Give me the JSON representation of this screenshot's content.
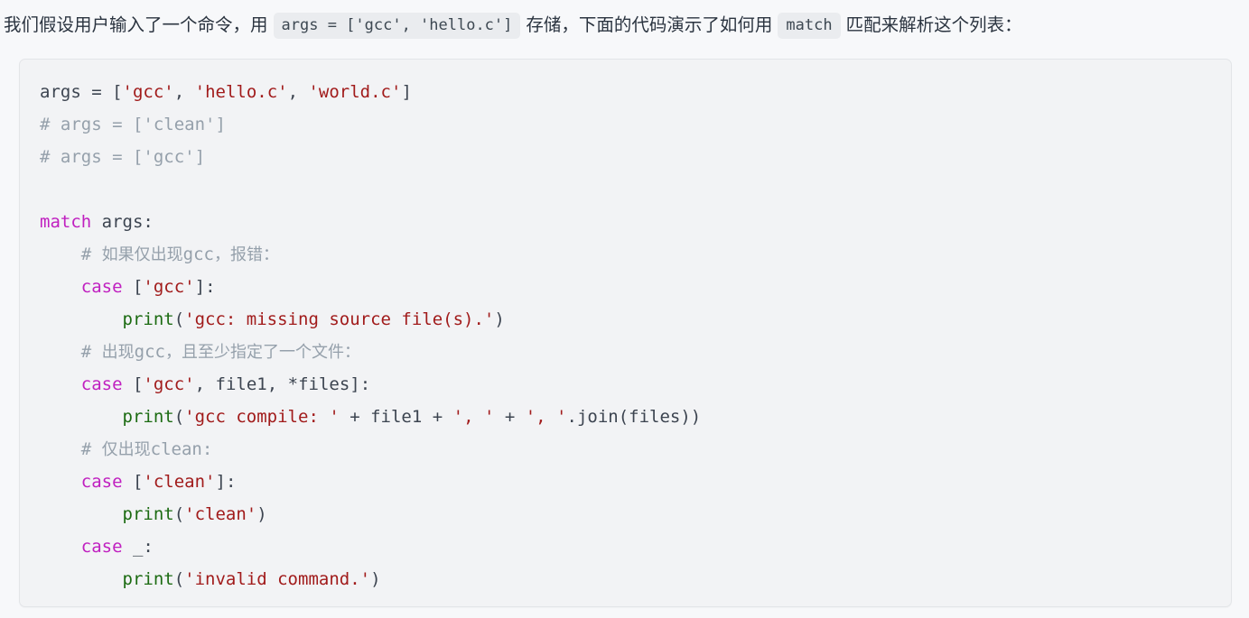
{
  "intro": {
    "segment_1": "我们假设用户输入了一个命令，用",
    "inline_code_1": "args = ['gcc', 'hello.c']",
    "segment_2": "存储，下面的代码演示了如何用",
    "inline_code_2": "match",
    "segment_3": "匹配来解析这个列表："
  },
  "code_block": {
    "language": "python",
    "background_color": "#f2f3f5",
    "border_color": "#e3e5e8",
    "colors": {
      "keyword": "#c020c0",
      "string": "#a11b1b",
      "comment": "#95a0ab",
      "function": "#1c6b12",
      "text": "#3c4450"
    },
    "lines": [
      {
        "indent": 0,
        "tokens": [
          {
            "t": "name",
            "v": "args"
          },
          {
            "t": "op",
            "v": " = "
          },
          {
            "t": "pun",
            "v": "["
          },
          {
            "t": "str",
            "v": "'gcc'"
          },
          {
            "t": "pun",
            "v": ", "
          },
          {
            "t": "str",
            "v": "'hello.c'"
          },
          {
            "t": "pun",
            "v": ", "
          },
          {
            "t": "str",
            "v": "'world.c'"
          },
          {
            "t": "pun",
            "v": "]"
          }
        ]
      },
      {
        "indent": 0,
        "tokens": [
          {
            "t": "com",
            "v": "# args = ['clean']"
          }
        ]
      },
      {
        "indent": 0,
        "tokens": [
          {
            "t": "com",
            "v": "# args = ['gcc']"
          }
        ]
      },
      {
        "indent": 0,
        "tokens": []
      },
      {
        "indent": 0,
        "tokens": [
          {
            "t": "kw",
            "v": "match"
          },
          {
            "t": "name",
            "v": " args"
          },
          {
            "t": "pun",
            "v": ":"
          }
        ]
      },
      {
        "indent": 4,
        "tokens": [
          {
            "t": "com",
            "v": "# 如果仅出现gcc，报错："
          }
        ]
      },
      {
        "indent": 4,
        "tokens": [
          {
            "t": "kw",
            "v": "case"
          },
          {
            "t": "pun",
            "v": " ["
          },
          {
            "t": "str",
            "v": "'gcc'"
          },
          {
            "t": "pun",
            "v": "]:"
          }
        ]
      },
      {
        "indent": 8,
        "tokens": [
          {
            "t": "fn",
            "v": "print"
          },
          {
            "t": "pun",
            "v": "("
          },
          {
            "t": "str",
            "v": "'gcc: missing source file(s).'"
          },
          {
            "t": "pun",
            "v": ")"
          }
        ]
      },
      {
        "indent": 4,
        "tokens": [
          {
            "t": "com",
            "v": "# 出现gcc，且至少指定了一个文件："
          }
        ]
      },
      {
        "indent": 4,
        "tokens": [
          {
            "t": "kw",
            "v": "case"
          },
          {
            "t": "pun",
            "v": " ["
          },
          {
            "t": "str",
            "v": "'gcc'"
          },
          {
            "t": "pun",
            "v": ", "
          },
          {
            "t": "name",
            "v": "file1"
          },
          {
            "t": "pun",
            "v": ", "
          },
          {
            "t": "op",
            "v": "*"
          },
          {
            "t": "name",
            "v": "files"
          },
          {
            "t": "pun",
            "v": "]:"
          }
        ]
      },
      {
        "indent": 8,
        "tokens": [
          {
            "t": "fn",
            "v": "print"
          },
          {
            "t": "pun",
            "v": "("
          },
          {
            "t": "str",
            "v": "'gcc compile: '"
          },
          {
            "t": "op",
            "v": " + "
          },
          {
            "t": "name",
            "v": "file1"
          },
          {
            "t": "op",
            "v": " + "
          },
          {
            "t": "str",
            "v": "', '"
          },
          {
            "t": "op",
            "v": " + "
          },
          {
            "t": "str",
            "v": "', '"
          },
          {
            "t": "pun",
            "v": "."
          },
          {
            "t": "name",
            "v": "join"
          },
          {
            "t": "pun",
            "v": "("
          },
          {
            "t": "name",
            "v": "files"
          },
          {
            "t": "pun",
            "v": "))"
          }
        ]
      },
      {
        "indent": 4,
        "tokens": [
          {
            "t": "com",
            "v": "# 仅出现clean:"
          }
        ]
      },
      {
        "indent": 4,
        "tokens": [
          {
            "t": "kw",
            "v": "case"
          },
          {
            "t": "pun",
            "v": " ["
          },
          {
            "t": "str",
            "v": "'clean'"
          },
          {
            "t": "pun",
            "v": "]:"
          }
        ]
      },
      {
        "indent": 8,
        "tokens": [
          {
            "t": "fn",
            "v": "print"
          },
          {
            "t": "pun",
            "v": "("
          },
          {
            "t": "str",
            "v": "'clean'"
          },
          {
            "t": "pun",
            "v": ")"
          }
        ]
      },
      {
        "indent": 4,
        "tokens": [
          {
            "t": "kw",
            "v": "case"
          },
          {
            "t": "name",
            "v": " _"
          },
          {
            "t": "pun",
            "v": ":"
          }
        ]
      },
      {
        "indent": 8,
        "tokens": [
          {
            "t": "fn",
            "v": "print"
          },
          {
            "t": "pun",
            "v": "("
          },
          {
            "t": "str",
            "v": "'invalid command.'"
          },
          {
            "t": "pun",
            "v": ")"
          }
        ]
      }
    ]
  }
}
